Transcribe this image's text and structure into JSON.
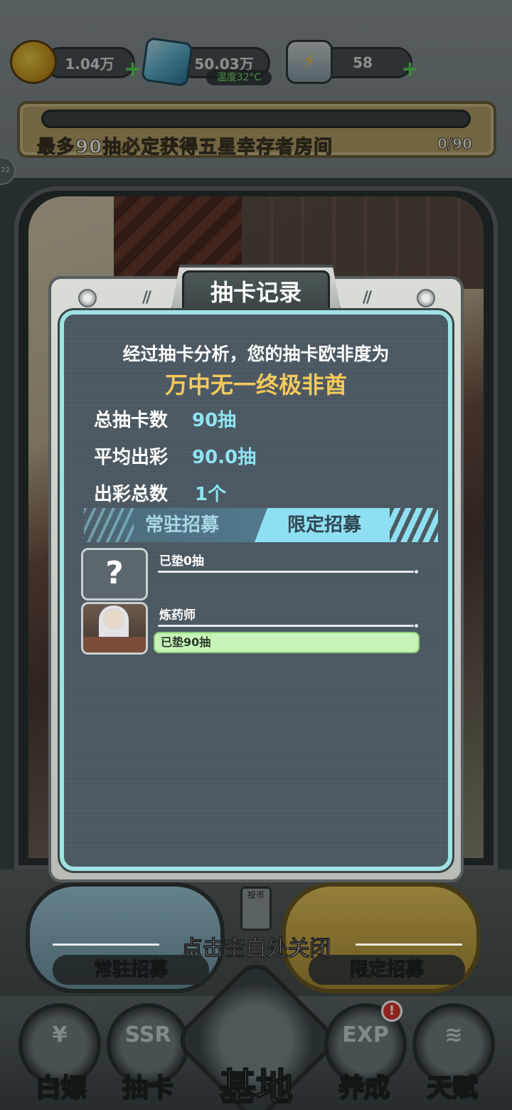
{
  "resources": {
    "coins": "1.04万",
    "gems": "50.03万",
    "temperature": "温度32°C",
    "energy": "58"
  },
  "banner": {
    "text": "最多90抽必定获得五星幸存者房间",
    "progress_text": "0/90",
    "progress": 0
  },
  "side_badge": "22",
  "dialog": {
    "title": "抽卡记录",
    "summary": "经过抽卡分析，您的抽卡欧非度为",
    "rank": "万中无一终极非酋",
    "stats": [
      {
        "label": "总抽卡数",
        "value": "90抽"
      },
      {
        "label": "平均出彩",
        "value": "90.0抽"
      },
      {
        "label": "出彩总数",
        "value": "1个"
      }
    ],
    "tabs": [
      {
        "label": "常驻招募",
        "active": false
      },
      {
        "label": "限定招募",
        "active": true
      }
    ],
    "records": [
      {
        "name": "",
        "pity": "已垫0抽",
        "icon": "question-mark-icon"
      },
      {
        "name": "炼药师",
        "pity": "已垫90抽",
        "icon": "alchemist-portrait"
      }
    ]
  },
  "close_hint": "点击空白处关闭",
  "pools": {
    "standard": "常驻招募",
    "limited": "限定招募",
    "coin_slot": "投币"
  },
  "nav": {
    "free": "白嫖",
    "gacha": "抽卡",
    "base": "基地",
    "develop": "养成",
    "talent": "天赋",
    "alert": "!"
  },
  "colors": {
    "accent_cyan": "#8fe3f2",
    "rank_gold": "#f6c95a",
    "pity_green": "#c7f3b8"
  }
}
